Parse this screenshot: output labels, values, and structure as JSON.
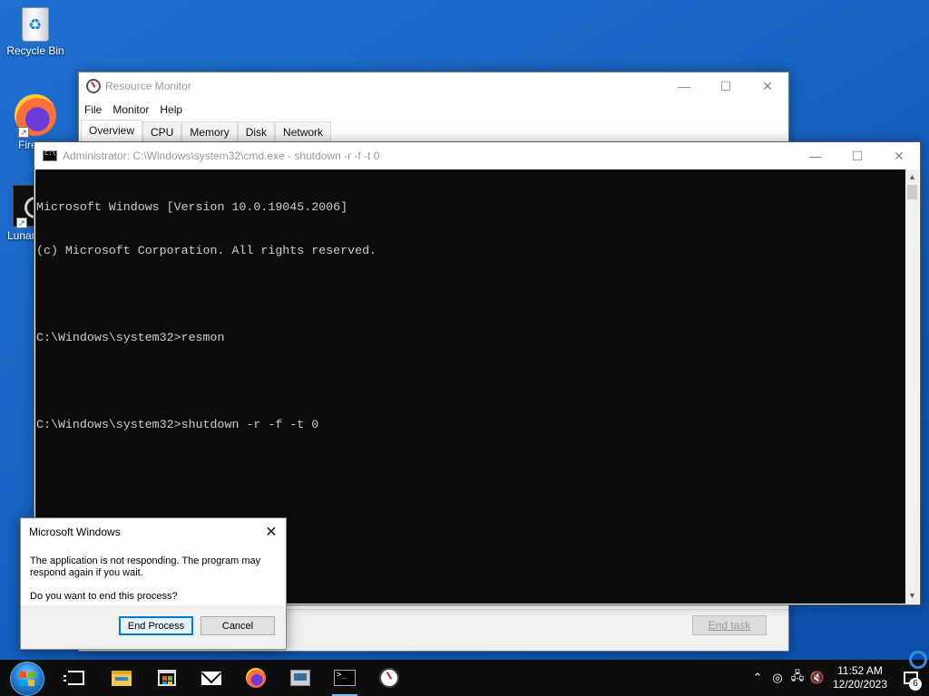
{
  "desktop": {
    "icons": [
      {
        "label": "Recycle Bin"
      },
      {
        "label": "Fire"
      },
      {
        "label": "Lunar"
      }
    ]
  },
  "resource_monitor": {
    "title": "Resource Monitor",
    "menu": [
      "File",
      "Monitor",
      "Help"
    ],
    "tabs": [
      "Overview",
      "CPU",
      "Memory",
      "Disk",
      "Network"
    ],
    "active_tab": "Overview",
    "end_task_label": "End task"
  },
  "cmd": {
    "title": "Administrator: C:\\Windows\\system32\\cmd.exe - shutdown  -r -f -t 0",
    "lines": [
      "Microsoft Windows [Version 10.0.19045.2006]",
      "(c) Microsoft Corporation. All rights reserved.",
      "",
      "C:\\Windows\\system32>resmon",
      "",
      "C:\\Windows\\system32>shutdown -r -f -t 0"
    ]
  },
  "dialog": {
    "title": "Microsoft Windows",
    "message": "The application is not responding. The program may respond again if you wait.",
    "question": "Do you want to end this process?",
    "end_process_label": "End Process",
    "cancel_label": "Cancel"
  },
  "taskbar": {
    "icons": [
      "start-icon",
      "task-view-icon",
      "file-explorer-icon",
      "store-icon",
      "mail-icon",
      "firefox-icon",
      "resource-monitor-app-icon",
      "command-prompt-icon",
      "resource-monitor-icon"
    ],
    "tray": {
      "time": "11:52 AM",
      "date": "12/20/2023",
      "notification_count": "6"
    }
  },
  "colors": {
    "desktop": "#1763c2",
    "console_bg": "#0c0c0c",
    "console_fg": "#cccccc",
    "accent": "#0078d7",
    "taskbar": "#0e0e0f"
  }
}
